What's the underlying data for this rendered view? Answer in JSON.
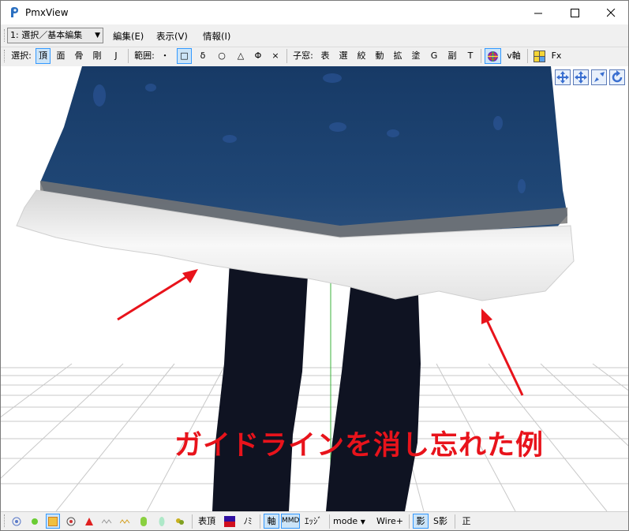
{
  "window": {
    "title": "PmxView"
  },
  "menubar": {
    "mode_value": "1: 選択／基本編集",
    "items": [
      "編集(E)",
      "表示(V)",
      "情報(I)"
    ]
  },
  "toolbar": {
    "select_label": "選択:",
    "select_items": [
      "頂",
      "面",
      "骨",
      "剛",
      "J"
    ],
    "range_label": "範囲:",
    "range_items": [
      "・",
      "□",
      "δ",
      "○",
      "△",
      "Φ",
      "×"
    ],
    "subwindow_label": "子窓:",
    "subwindow_items": [
      "表",
      "選",
      "絞",
      "動",
      "拡",
      "塗",
      "G",
      "副",
      "T"
    ],
    "axis_label": "v軸",
    "fx_label": "Fx"
  },
  "viewport": {
    "annotation": "ガイドラインを消し忘れた例"
  },
  "statusbar": {
    "morph_label": "表頂",
    "mirror_label": "ﾉﾐ",
    "axis_label": "軸",
    "mmd_label": "MMD",
    "edge_label": "ｴｯｼﾞ",
    "mode_label": "mode",
    "wire_label": "Wire+",
    "shadow_label": "影",
    "sshadow_label": "S影",
    "correct_label": "正"
  },
  "colors": {
    "accent": "#3399ff",
    "annotation": "#e8131b",
    "skirt": "#1f3f6e"
  }
}
